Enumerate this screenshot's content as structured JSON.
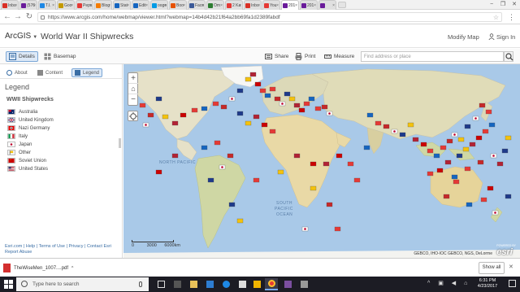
{
  "browser": {
    "tabs": [
      {
        "label": "Inbo",
        "color": "#d93025"
      },
      {
        "label": "(576",
        "color": "#6a1b9a"
      },
      {
        "label": "T.I.",
        "color": "#1e88e5"
      },
      {
        "label": "Goo",
        "color": "#c49a00"
      },
      {
        "label": "Peps",
        "color": "#e53935"
      },
      {
        "label": "Blog",
        "color": "#f57c00"
      },
      {
        "label": "Stat",
        "color": "#1565c0"
      },
      {
        "label": "Edit",
        "color": "#1565c0"
      },
      {
        "label": "ooge",
        "color": "#039be5"
      },
      {
        "label": "Boo",
        "color": "#e65100"
      },
      {
        "label": "Face",
        "color": "#3b5998"
      },
      {
        "label": "Om",
        "color": "#2e7d32"
      },
      {
        "label": "2 Ka",
        "color": "#e53935"
      },
      {
        "label": "Inbo",
        "color": "#d93025"
      },
      {
        "label": "You",
        "color": "#e53935"
      },
      {
        "label": "201",
        "color": "#6a1b9a"
      },
      {
        "label": "201",
        "color": "#6a1b9a"
      },
      {
        "label": "",
        "color": "#6a1b9a"
      }
    ],
    "url": "https://www.arcgis.com/home/webmap/viewer.html?webmap=14b4d42b21f64a2bb69fa1d2389fabdf",
    "window_buttons": [
      "−",
      "❐",
      "✕"
    ]
  },
  "app": {
    "logo": "ArcGIS",
    "title": "World War II Shipwrecks",
    "modify_map": "Modify Map",
    "sign_in": "Sign In"
  },
  "toolbar": {
    "details": "Details",
    "basemap": "Basemap",
    "share": "Share",
    "print": "Print",
    "measure": "Measure",
    "search_placeholder": "Find address or place"
  },
  "panel": {
    "tabs": {
      "about": "About",
      "content": "Content",
      "legend": "Legend"
    },
    "legend_title": "Legend",
    "layer_title": "WWII Shipwrecks",
    "legend_items": [
      {
        "label": "Australia",
        "flag": "australia"
      },
      {
        "label": "United Kingdom",
        "flag": "uk"
      },
      {
        "label": "Nazi Germany",
        "flag": "germany"
      },
      {
        "label": "Italy",
        "flag": "italy"
      },
      {
        "label": "Japan",
        "flag": "japan"
      },
      {
        "label": "Other",
        "flag": "other"
      },
      {
        "label": "Soviet Union",
        "flag": "soviet"
      },
      {
        "label": "United States",
        "flag": "usa"
      }
    ],
    "footer_line1": "Esri.com  |  Help  |  Terms of Use  |  Privacy  |  Contact Esri",
    "footer_line2": "Report Abuse"
  },
  "map": {
    "ocean_labels": [
      "SOUTH",
      "PACIFIC",
      "OCEAN"
    ],
    "scale": {
      "left": "0",
      "mid": "3000",
      "right": "6000km"
    },
    "attribution": "GEBCO, IHO-IOC GEBCO, NGS, DeLorme",
    "esri_logo": "esri",
    "esri_powered": "POWERED BY"
  },
  "downloads": {
    "file": "TheWiseMen_1007....pdf",
    "show_all": "Show all"
  },
  "taskbar": {
    "search": "Type here to search",
    "time": "6:31 PM",
    "date": "4/23/2017",
    "tray": "^ ▣ ◀ ⌂"
  }
}
